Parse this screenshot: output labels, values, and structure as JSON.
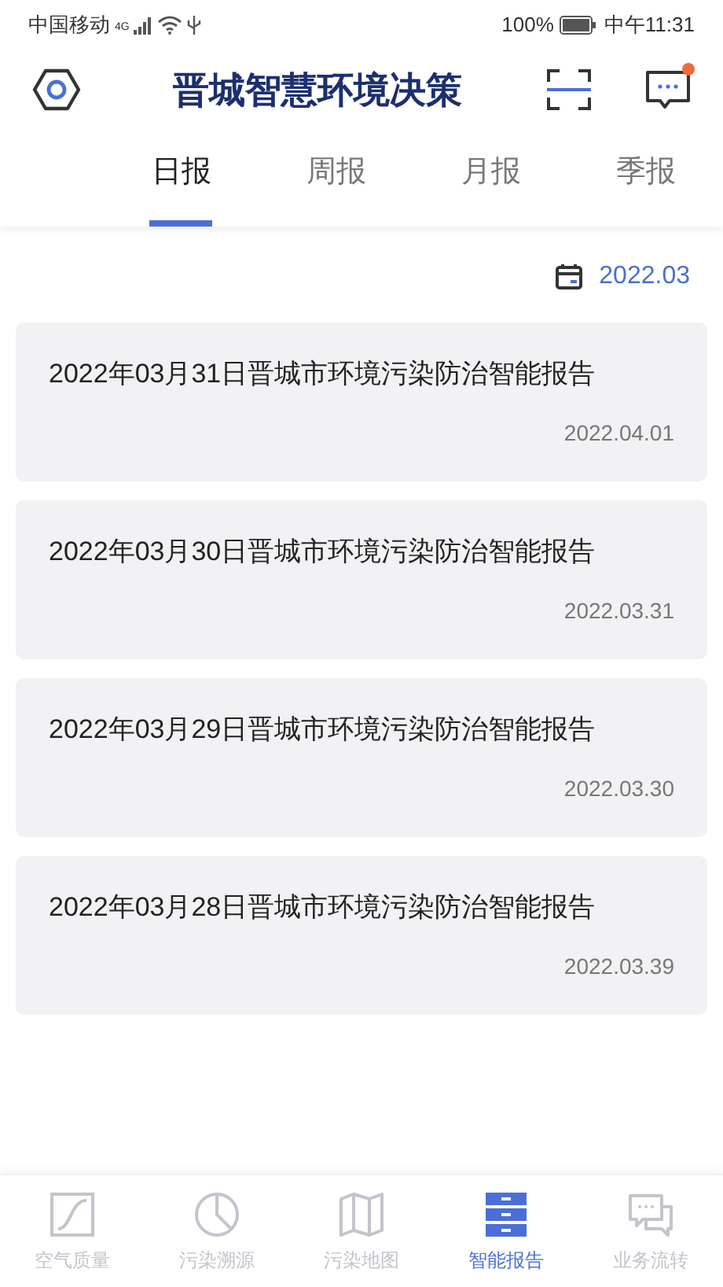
{
  "status_bar": {
    "carrier": "中国移动",
    "network": "4G",
    "battery": "100%",
    "time": "中午11:31"
  },
  "header": {
    "title": "晋城智慧环境决策",
    "message_unread": true
  },
  "tabs": [
    {
      "label": "日报",
      "selected": true
    },
    {
      "label": "周报",
      "selected": false
    },
    {
      "label": "月报",
      "selected": false
    },
    {
      "label": "季报",
      "selected": false
    }
  ],
  "date_filter": {
    "value": "2022.03"
  },
  "reports": [
    {
      "title": "2022年03月31日晋城市环境污染防治智能报告",
      "date": "2022.04.01"
    },
    {
      "title": "2022年03月30日晋城市环境污染防治智能报告",
      "date": "2022.03.31"
    },
    {
      "title": "2022年03月29日晋城市环境污染防治智能报告",
      "date": "2022.03.30"
    },
    {
      "title": "2022年03月28日晋城市环境污染防治智能报告",
      "date": "2022.03.39"
    }
  ],
  "bottom_nav": [
    {
      "kind": "curve",
      "label": "空气质量",
      "selected": false
    },
    {
      "kind": "pie",
      "label": "污染溯源",
      "selected": false
    },
    {
      "kind": "map",
      "label": "污染地图",
      "selected": false
    },
    {
      "kind": "drawers",
      "label": "智能报告",
      "selected": true
    },
    {
      "kind": "chat",
      "label": "业务流转",
      "selected": false
    }
  ]
}
